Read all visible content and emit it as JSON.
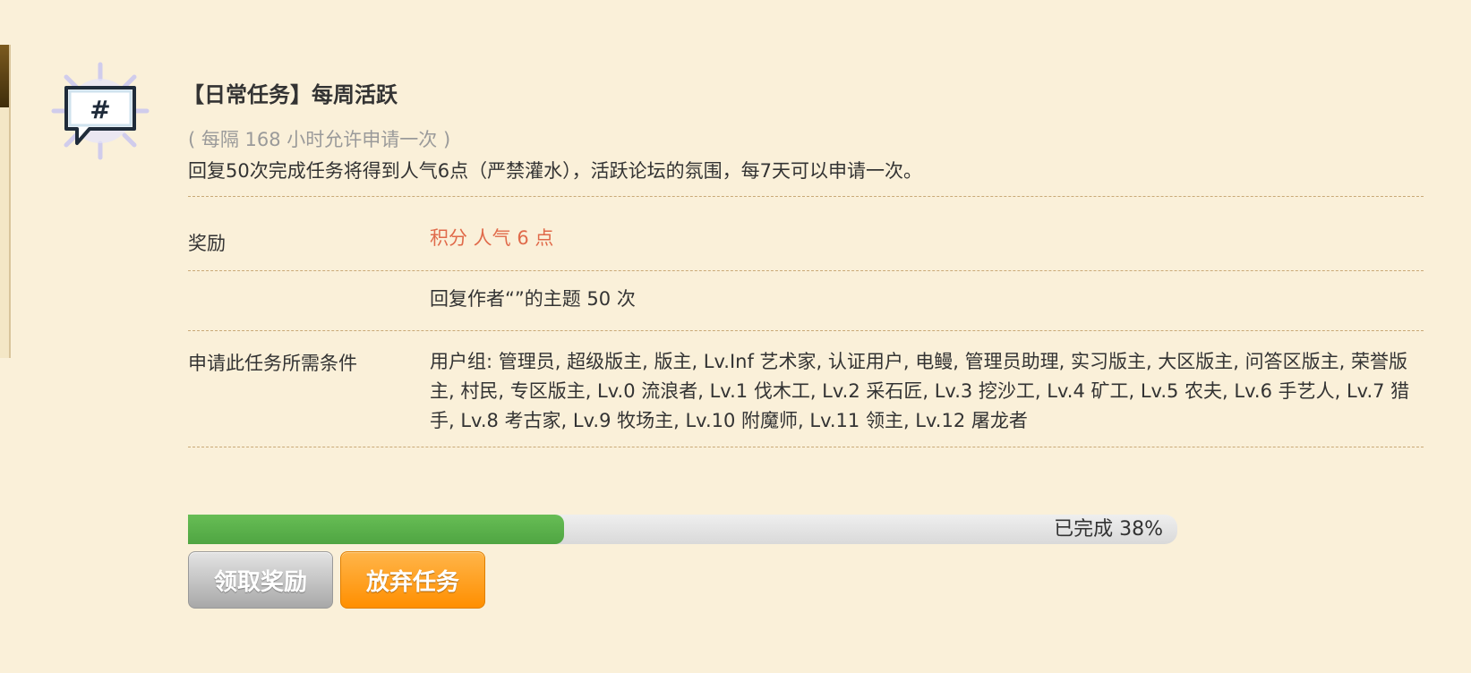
{
  "task": {
    "title": "【日常任务】每周活跃",
    "period": "( 每隔 168 小时允许申请一次 )",
    "description": "回复50次完成任务将得到人气6点（严禁灌水），活跃论坛的氛围，每7天可以申请一次。",
    "icon": "speech-bubble-hash-icon"
  },
  "details": {
    "reward_label": "奖励",
    "reward_value": "积分 人气 6 点",
    "condition_label": "",
    "condition_value": "回复作者“”的主题 50 次",
    "requirement_label": "申请此任务所需条件",
    "requirement_value": "用户组: 管理员, 超级版主, 版主, Lv.Inf 艺术家, 认证用户, 电鳗, 管理员助理, 实习版主, 大区版主, 问答区版主, 荣誉版主, 村民, 专区版主, Lv.0 流浪者, Lv.1 伐木工, Lv.2 采石匠, Lv.3 挖沙工, Lv.4 矿工, Lv.5 农夫, Lv.6 手艺人, Lv.7 猎手, Lv.8 考古家, Lv.9 牧场主, Lv.10 附魔师, Lv.11 领主, Lv.12 屠龙者"
  },
  "progress": {
    "label": "已完成 38%",
    "percent": 38
  },
  "buttons": {
    "claim_label": "领取奖励",
    "abandon_label": "放弃任务"
  },
  "colors": {
    "background": "#faf0d9",
    "reward_text": "#e06a4a",
    "progress_fill": "#5aad4a",
    "abandon_button": "#ff9a1a",
    "claim_button": "#b5b5b5"
  }
}
